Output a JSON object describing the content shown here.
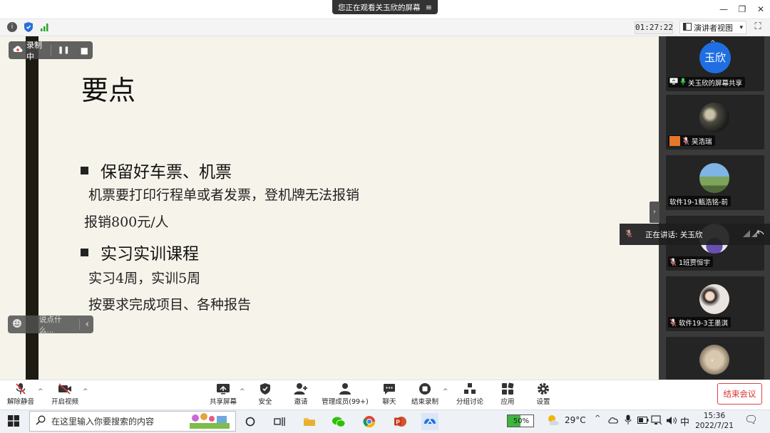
{
  "window": {
    "share_banner": "您正在观看关玉欣的屏幕",
    "menu_icon": "≡",
    "minimize": "—",
    "restore": "❐",
    "close": "✕"
  },
  "topbar": {
    "info_icon": "i",
    "timer": "01:27:22",
    "view_label": "演讲者视图",
    "view_caret": "▾",
    "fullscreen": "⛶"
  },
  "recording": {
    "status": "录制中",
    "pause_icon": "❚❚",
    "stop_icon": "■"
  },
  "slide": {
    "title": "要点",
    "points": [
      {
        "heading": "保留好车票、机票",
        "details": [
          "机票要打印行程单或者发票，登机牌无法报销",
          "报销800元/人"
        ]
      },
      {
        "heading": "实习实训课程",
        "details": [
          "实习4周，实训5周",
          "按要求完成项目、各种报告"
        ]
      }
    ]
  },
  "chat": {
    "placeholder": "说点什么...",
    "collapse": "‹"
  },
  "participants": [
    {
      "name": "关玉欣的屏幕共享",
      "avatar_text": "玉欣"
    },
    {
      "name": "吴浩瑞"
    },
    {
      "name": "软件19-1甄浩铭-前"
    },
    {
      "name": "1班贾恒宇"
    },
    {
      "name": "软件19-3王墨淇"
    },
    {
      "name": ""
    }
  ],
  "avatar_up": "^",
  "avatar_down": "˅",
  "speaking": {
    "label": "正在讲话: 关玉欣"
  },
  "side_toggle": "›",
  "toolbar": {
    "unmute": "解除静音",
    "start_video": "开启视频",
    "share_screen": "共享屏幕",
    "security": "安全",
    "invite": "邀请",
    "manage_members": "管理成员(99+)",
    "chat": "聊天",
    "end_recording": "结束录制",
    "breakout": "分组讨论",
    "apps": "应用",
    "settings": "设置",
    "end_meeting": "结束会议",
    "caret": "^"
  },
  "taskbar": {
    "search_placeholder": "在这里输入你要搜索的内容",
    "battery": "50%",
    "temperature": "29°C",
    "ime": "中",
    "time": "15:36",
    "date": "2022/7/21",
    "notification": "🗨"
  }
}
